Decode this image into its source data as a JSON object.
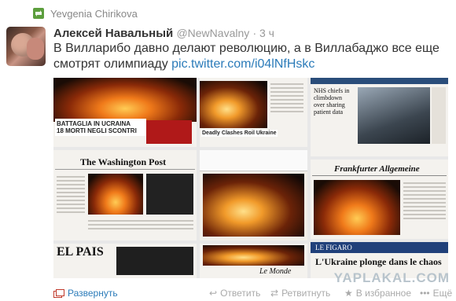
{
  "retweet": {
    "icon": "retweet-icon",
    "by": "Yevgenia Chirikova"
  },
  "tweet": {
    "author_name": "Алексей Навальный",
    "author_handle": "@NewNavalny",
    "time": "· 3 ч",
    "text": "В Вилларибо давно делают революцию, а в Виллабаджо все еще смотрят олимпиаду ",
    "link": "pic.twitter.com/i04lNfHskc"
  },
  "collage": {
    "tiles": [
      {
        "headline": "BATTAGLIA IN UCRAINA\n18 MORTI NEGLI SCONTRI"
      },
      {
        "headline": "Deadly Clashes Roil Ukraine"
      },
      {
        "headline": "NHS chiefs in climbdown over sharing patient data"
      },
      {
        "masthead": "The Washington Post"
      },
      {
        "masthead": "Frankfurter Allgemeine"
      },
      {
        "masthead": "EL PAIS"
      },
      {
        "masthead": "Le Monde"
      },
      {
        "masthead": "LE FIGARO",
        "headline": "L'Ukraine plonge dans le chaos"
      }
    ]
  },
  "watermark": "YAPLAKAL.COM",
  "actions": {
    "expand": "Развернуть",
    "reply": "Ответить",
    "retweet": "Ретвитнуть",
    "favorite": "В избранное",
    "more": "Ещё"
  },
  "colors": {
    "link": "#2b7bb9",
    "muted": "#999999",
    "text": "#333333"
  }
}
